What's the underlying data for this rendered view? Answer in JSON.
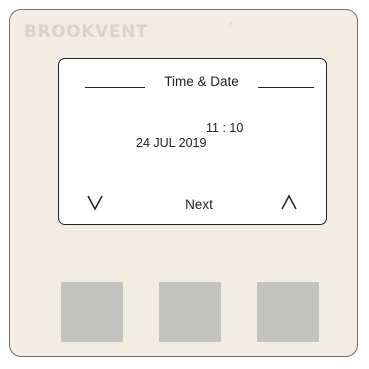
{
  "device": {
    "brand": "BROOKVENT",
    "brand_mark": "®"
  },
  "screen": {
    "title": "Time & Date",
    "time": "11 : 10",
    "date": "24 JUL 2019",
    "next_label": "Next",
    "down_icon": "chevron-down-icon",
    "up_icon": "chevron-up-icon"
  },
  "buttons": [
    {
      "label": "",
      "color": "#c3c3c1"
    },
    {
      "label": "",
      "color": "#c3c3c1"
    },
    {
      "label": "",
      "color": "#c3c3c1"
    }
  ],
  "colors": {
    "panel": "#f1ede3",
    "screen": "#ffffff",
    "text": "#222222",
    "logo": "#d7d3ca"
  }
}
